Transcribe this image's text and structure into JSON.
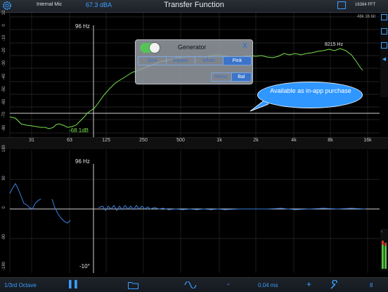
{
  "header": {
    "input_name": "Internal Mic",
    "level": "67.3 dBA",
    "title": "Transfer Function",
    "fft_size": "16384 FFT",
    "sample_rate": "48k 16 bit"
  },
  "magnitude": {
    "y_ticks": [
      "10",
      "0",
      "-10",
      "-20",
      "-30",
      "-40",
      "-50",
      "-60",
      "-70",
      "-80"
    ],
    "cursor_freq": "96 Hz",
    "cursor_level": "-68.1dB",
    "peak_freq": "8215 Hz",
    "trace_color": "#78e04e"
  },
  "x_axis": {
    "ticks": [
      "31",
      "63",
      "125",
      "250",
      "500",
      "1k",
      "2k",
      "4k",
      "8k",
      "16k"
    ]
  },
  "phase": {
    "y_ticks": [
      "180",
      "90",
      "0",
      "-90",
      "-180"
    ],
    "cursor_freq": "96 Hz",
    "cursor_phase": "-10°",
    "trace_color": "#3a7fe0"
  },
  "generator": {
    "title": "Generator",
    "close_label": "X",
    "enabled": true,
    "signal_types": [
      "Sine",
      "Square",
      "White",
      "Pink"
    ],
    "selected_signal": "Pink",
    "channel_modes": [
      "Mono",
      "Bal"
    ],
    "selected_channel": "Bal"
  },
  "callout": {
    "text": "Available as in-app purchase"
  },
  "toolbar": {
    "smoothing": "1/3rd Octave",
    "delay": "0.04 ms",
    "minus_label": "-",
    "plus_label": "+",
    "average_count": "8"
  },
  "colors": {
    "accent": "#3aa0ff",
    "magnitude": "#78e04e",
    "phase": "#3a7fe0",
    "toggle_on": "#58c25a",
    "callout": "#2f97ff"
  }
}
